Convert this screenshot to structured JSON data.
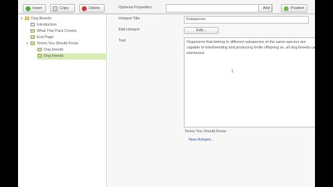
{
  "toolbar": {
    "insert": "Insert",
    "copy": "Copy",
    "delete": "Delete",
    "optional_properties_label": "Optional Properties:",
    "optional_properties_value": "",
    "add": "Add",
    "position": "Position"
  },
  "tree": {
    "root": "Dog Breeds",
    "items": [
      {
        "label": "Introduction"
      },
      {
        "label": "What This Pack Covers"
      },
      {
        "label": "End Page"
      },
      {
        "label": "Terms You Should Know"
      },
      {
        "label": "Dog breeds"
      },
      {
        "label": "Dog breeds"
      }
    ]
  },
  "form": {
    "hotspot_title_label": "Hotspot Title",
    "hotspot_title_value": "Subspecies",
    "edit_hotspot_label": "Edit Hotspot",
    "edit_button": "Edit...",
    "text_label": "Text",
    "text_value": "Organisms that belong to different subspecies of the same species are capable of interbreeding and producing fertile offspring so, all dog breeds can, interbreed.",
    "section_label": "Terms You Should Know",
    "new_hotspot": "New Hotspot..."
  },
  "colors": {
    "selection": "#d7ecb4",
    "link": "#2a56b8",
    "add_icon": "#4caa3c",
    "delete_icon": "#d0362f"
  }
}
